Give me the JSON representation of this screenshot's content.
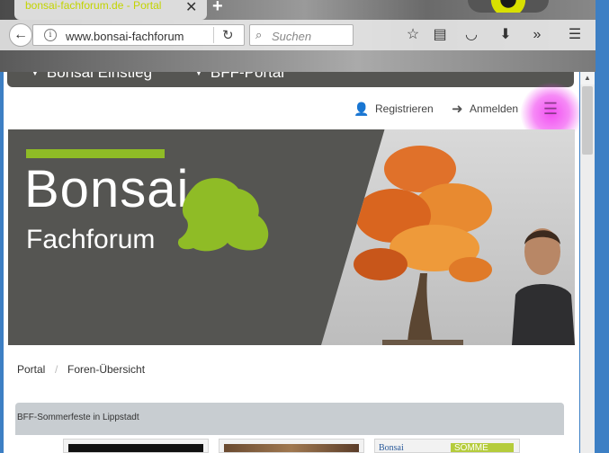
{
  "browser": {
    "tab_title": "bonsai-fachforum.de - Portal",
    "tab_close": "✕",
    "new_tab": "+",
    "url": "www.bonsai-fachforum",
    "search_placeholder": "Suchen",
    "toolbar_icons": [
      "star-icon",
      "reading-list-icon",
      "pocket-icon",
      "download-icon",
      "overflow-icon",
      "hamburger-menu-icon"
    ]
  },
  "site_nav": {
    "items": [
      {
        "label": "Bonsai Einstieg"
      },
      {
        "label": "BFF-Portal"
      }
    ]
  },
  "account": {
    "register_label": "Registrieren",
    "login_label": "Anmelden",
    "menu_highlight_color": "#f03cf0"
  },
  "banner": {
    "title": "Bonsai",
    "subtitle": "Fachforum",
    "accent_color": "#8fbc26",
    "background_color": "#555552"
  },
  "breadcrumb": {
    "items": [
      "Portal",
      "Foren-Übersicht"
    ],
    "separator": "/"
  },
  "section": {
    "title": "BFF-Sommerfeste in Lippstadt",
    "thumb3_text": "Bonsai",
    "thumb3_badge": "SOMME"
  }
}
